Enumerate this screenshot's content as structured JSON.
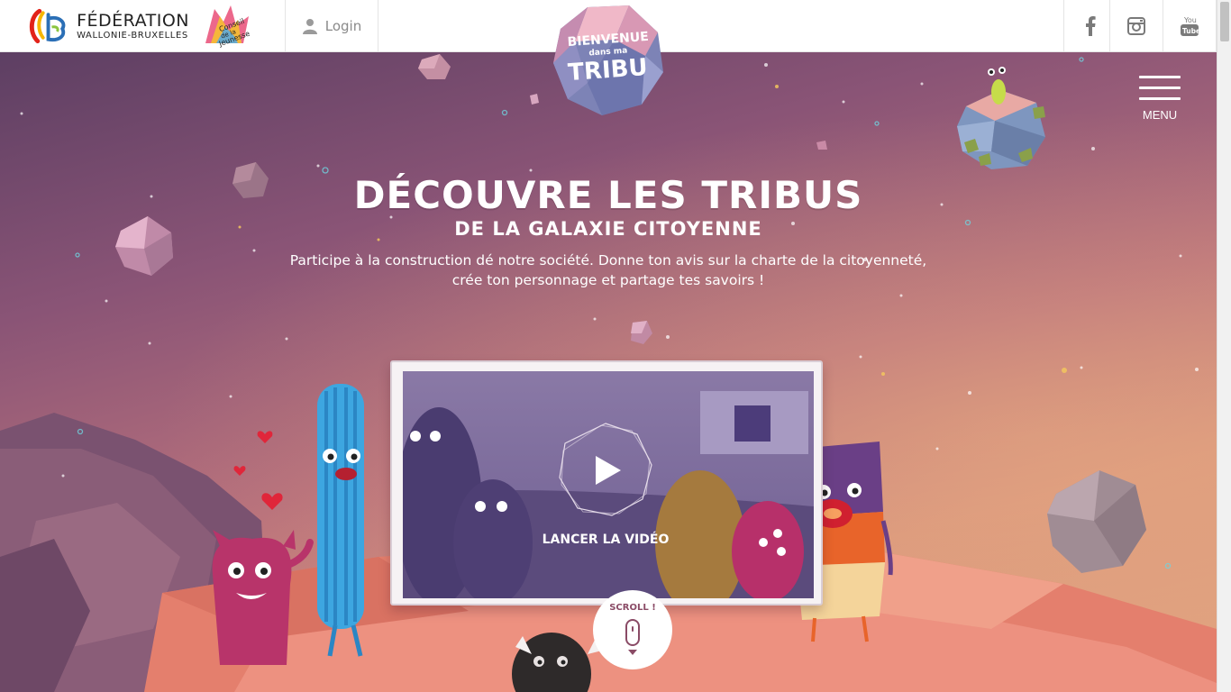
{
  "header": {
    "fwb_title": "FÉDÉRATION",
    "fwb_subtitle": "WALLONIE-BRUXELLES",
    "cj_logo_text": "Conseil de la Jeunesse",
    "login_label": "Login",
    "social": [
      {
        "name": "facebook",
        "icon": "facebook-icon"
      },
      {
        "name": "instagram",
        "icon": "instagram-icon"
      },
      {
        "name": "youtube",
        "icon": "youtube-icon",
        "text": "You Tube"
      }
    ]
  },
  "logo": {
    "line1": "BIENVENUE",
    "line2": "dans ma",
    "line3": "TRIBU"
  },
  "menu": {
    "label": "MENU"
  },
  "hero": {
    "title": "DÉCOUVRE LES TRIBUS",
    "subtitle": "DE LA GALAXIE CITOYENNE",
    "intro": "Participe à la construction dé notre société. Donne ton avis sur la charte de la citoyenneté, crée ton personnage et partage tes savoirs !",
    "video_label": "LANCER LA VIDÉO",
    "scroll_label": "SCROLL !"
  },
  "colors": {
    "background_top": "#5d3f63",
    "background_bottom": "#e0a27f",
    "ground": "#e8846f",
    "text": "#ffffff",
    "scroll_accent": "#8a4b66"
  }
}
